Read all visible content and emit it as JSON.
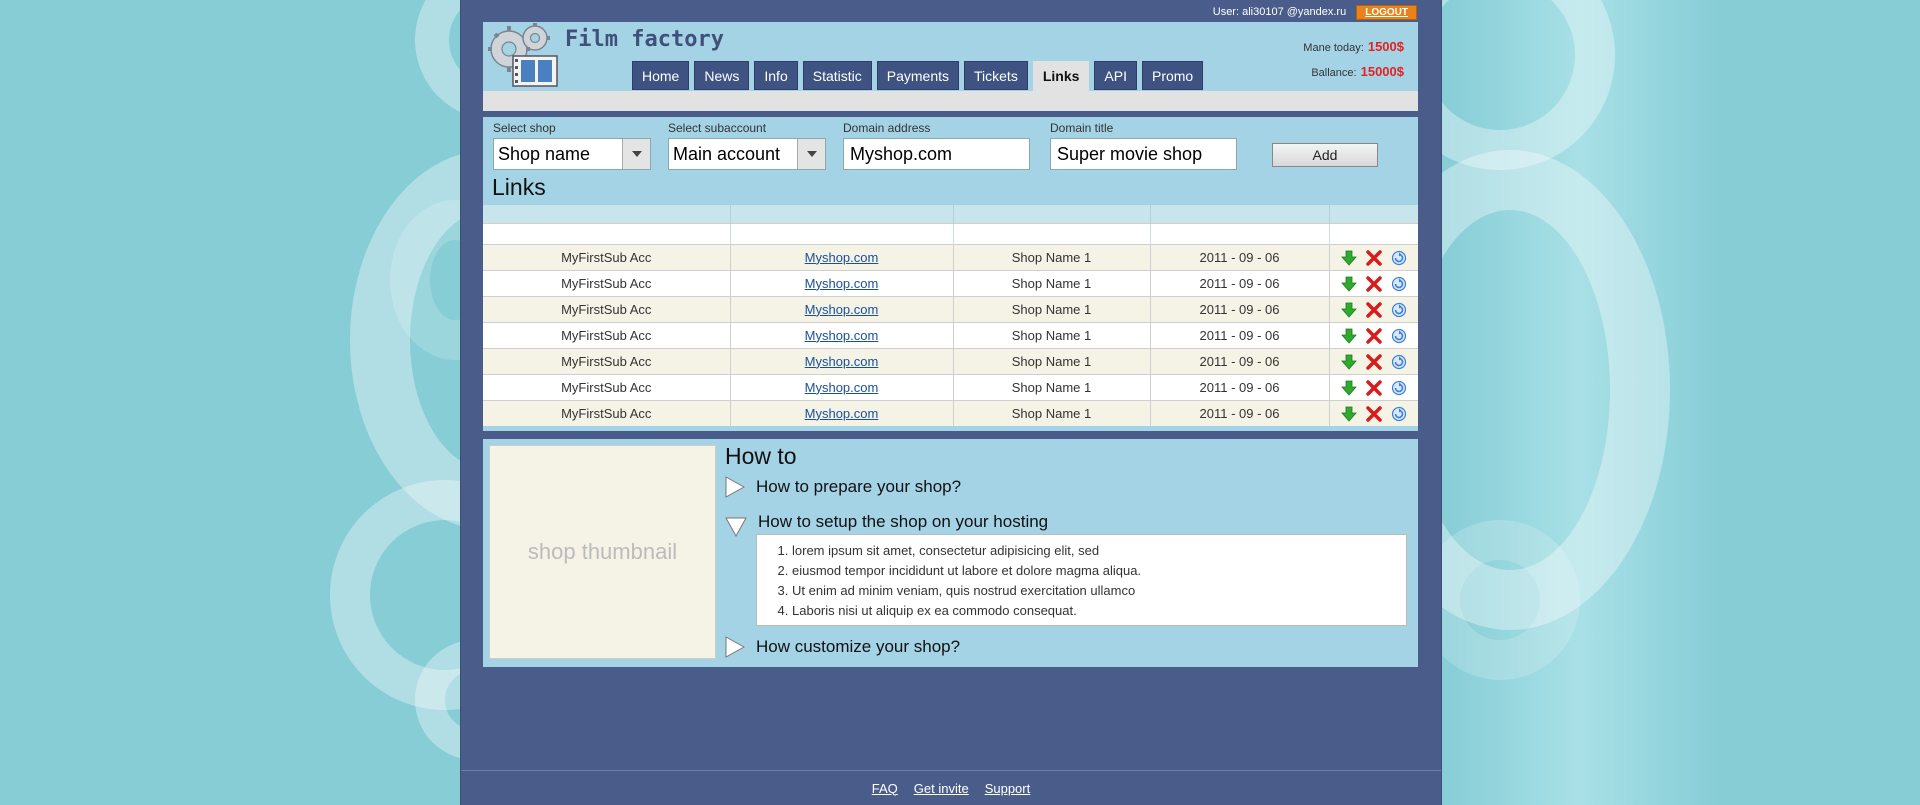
{
  "topbar": {
    "user_text": "User: ali30107 @yandex.ru",
    "logout_label": "LOGOUT"
  },
  "logo": {
    "title": "Film factory",
    "icon": "film-gears-logo-icon"
  },
  "nav": {
    "tabs": [
      {
        "label": "Home"
      },
      {
        "label": "News"
      },
      {
        "label": "Info"
      },
      {
        "label": "Statistic"
      },
      {
        "label": "Payments"
      },
      {
        "label": "Tickets"
      },
      {
        "label": "Links",
        "active": true
      },
      {
        "label": "API"
      },
      {
        "label": "Promo"
      }
    ]
  },
  "stats": {
    "mane_label": "Mane today:",
    "mane_value": "1500$",
    "balance_label": "Ballance:",
    "balance_value": "15000$"
  },
  "form": {
    "shop_label": "Select shop",
    "shop_value": "Shop name",
    "subaccount_label": "Select subaccount",
    "subaccount_value": "Main account",
    "domain_label": "Domain address",
    "domain_value": "Myshop.com",
    "title_label": "Domain title",
    "title_value": "Super movie shop",
    "add_label": "Add"
  },
  "links": {
    "title": "Links",
    "rows": [
      {
        "account": "MyFirstSub Acc",
        "domain": "Myshop.com",
        "shop": "Shop Name  1",
        "date": "2011 - 09 - 06"
      },
      {
        "account": "MyFirstSub Acc",
        "domain": "Myshop.com",
        "shop": "Shop Name  1",
        "date": "2011 - 09 - 06"
      },
      {
        "account": "MyFirstSub Acc",
        "domain": "Myshop.com",
        "shop": "Shop Name  1",
        "date": "2011 - 09 - 06"
      },
      {
        "account": "MyFirstSub Acc",
        "domain": "Myshop.com",
        "shop": "Shop Name  1",
        "date": "2011 - 09 - 06"
      },
      {
        "account": "MyFirstSub Acc",
        "domain": "Myshop.com",
        "shop": "Shop Name  1",
        "date": "2011 - 09 - 06"
      },
      {
        "account": "MyFirstSub Acc",
        "domain": "Myshop.com",
        "shop": "Shop Name  1",
        "date": "2011 - 09 - 06"
      },
      {
        "account": "MyFirstSub Acc",
        "domain": "Myshop.com",
        "shop": "Shop Name  1",
        "date": "2011 - 09 - 06"
      }
    ],
    "action_icons": [
      "download-arrow-icon",
      "delete-x-icon",
      "refresh-icon"
    ],
    "colors": {
      "download": "#2faa2f",
      "delete": "#d81c1c",
      "refresh": "#3a7fd6"
    }
  },
  "howto": {
    "thumbnail_label": "shop thumbnail",
    "title": "How to",
    "items": [
      {
        "label": "How to prepare your shop?",
        "expanded": false
      },
      {
        "label": "How to  setup the shop on your hosting",
        "expanded": true
      },
      {
        "label": "How customize your shop?",
        "expanded": false
      }
    ],
    "steps": [
      "lorem ipsum sit amet, consectetur  adipisicing elit, sed",
      "eiusmod tempor incididunt ut labore et dolore magma aliqua.",
      "Ut enim ad minim veniam, quis nostrud exercitation ullamco",
      "Laboris nisi ut aliquip ex ea commodo consequat."
    ]
  },
  "footer": {
    "links": [
      {
        "label": "FAQ"
      },
      {
        "label": "Get invite"
      },
      {
        "label": "Support"
      }
    ]
  },
  "colors": {
    "page_bg": "#86cdd6",
    "frame": "#4a5d8a",
    "panel": "#a5d3e6",
    "nav_tab": "#3e5382",
    "accent_red": "#e52121",
    "logout_orange": "#e8821a"
  }
}
